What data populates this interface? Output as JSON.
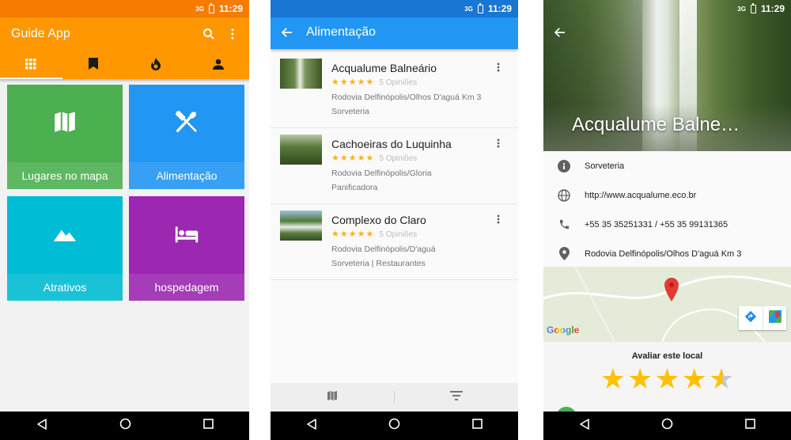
{
  "status": {
    "network": "3G",
    "time": "11:29"
  },
  "home": {
    "title": "Guide App",
    "tabs": [
      "grid-icon",
      "bookmark-icon",
      "fire-icon",
      "person-icon"
    ],
    "tiles": [
      {
        "label": "Lugares no mapa",
        "icon": "map-icon",
        "color": "#4caf50"
      },
      {
        "label": "Alimentação",
        "icon": "restaurant-icon",
        "color": "#2196f3"
      },
      {
        "label": "Atrativos",
        "icon": "landscape-icon",
        "color": "#00bcd4"
      },
      {
        "label": "hospedagem",
        "icon": "hotel-icon",
        "color": "#9c27b0"
      }
    ]
  },
  "list": {
    "title": "Alimentação",
    "items": [
      {
        "title": "Acqualume Balneário",
        "rating": 4.5,
        "reviews": "5 Opiniões",
        "address": "Rodovia Delfinópolis/Olhos D'aguá Km 3",
        "category": "Sorveteria"
      },
      {
        "title": "Cachoeiras do Luquinha",
        "rating": 4.5,
        "reviews": "5 Opiniões",
        "address": "Rodovia Delfinópolis/Gloria",
        "category": "Panificadora"
      },
      {
        "title": "Complexo do Claro",
        "rating": 4.5,
        "reviews": "5 Opiniões",
        "address": "Rodovia Delfinópolis/D'aguá",
        "category": "Sorveteria | Restaurantes"
      }
    ]
  },
  "detail": {
    "title": "Acqualume Balne…",
    "rows": [
      {
        "icon": "info-icon",
        "text": "Sorveteria"
      },
      {
        "icon": "globe-icon",
        "text": "http://www.acqualume.eco.br"
      },
      {
        "icon": "phone-icon",
        "text": "+55 35 35251331 / +55 35 99131365"
      },
      {
        "icon": "location-icon",
        "text": "Rodovia Delfinópolis/Olhos D'aguá Km 3"
      }
    ],
    "map_brand": "Google",
    "rate_label": "Avaliar este local",
    "rating": 4.5
  }
}
